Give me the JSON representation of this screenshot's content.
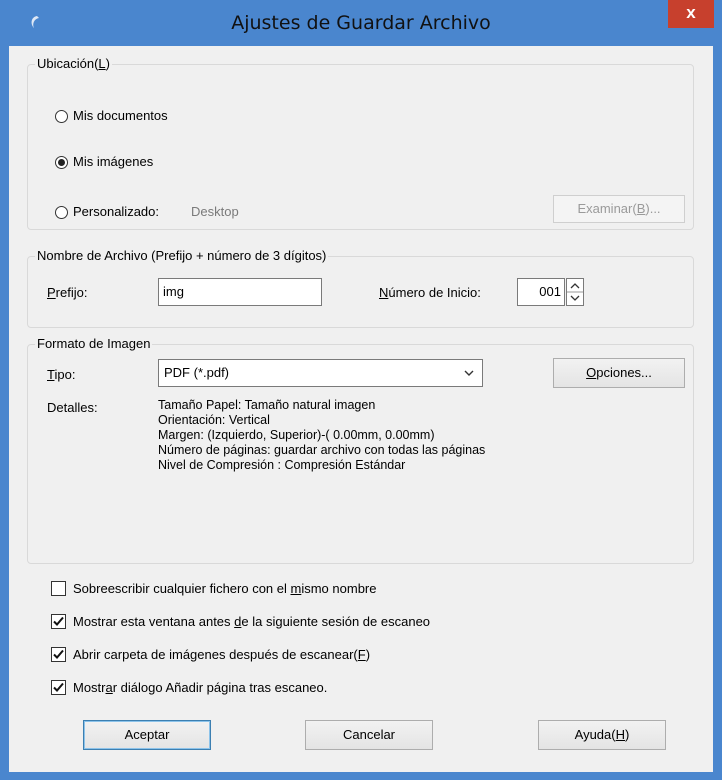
{
  "window": {
    "title": "Ajustes de Guardar Archivo",
    "close_glyph": "x"
  },
  "location": {
    "group_label_pre": "Ubicación(",
    "group_label_key": "L",
    "group_label_post": ")",
    "options": [
      {
        "label": "Mis documentos",
        "selected": false
      },
      {
        "label": "Mis imágenes",
        "selected": true
      },
      {
        "label": "Personalizado:",
        "selected": false
      }
    ],
    "custom_path": "Desktop",
    "browse_pre": "Examinar(",
    "browse_key": "B",
    "browse_post": ")..."
  },
  "filename": {
    "group_label": "Nombre de Archivo (Prefijo + número de 3 dígitos)",
    "prefix_key": "P",
    "prefix_rest": "refijo:",
    "prefix_value": "img",
    "start_key": "N",
    "start_rest": "úmero de Inicio:",
    "start_value": "001"
  },
  "format": {
    "group_label": "Formato de Imagen",
    "type_key": "T",
    "type_rest": "ipo:",
    "type_value": "PDF (*.pdf)",
    "options_key": "O",
    "options_rest": "pciones...",
    "details_label": "Detalles:",
    "details": [
      "Tamaño Papel: Tamaño natural imagen",
      "Orientación: Vertical",
      "Margen: (Izquierdo, Superior)-( 0.00mm, 0.00mm)",
      "Número de páginas: guardar archivo con todas las páginas",
      "Nivel de Compresión : Compresión Estándar"
    ]
  },
  "checkboxes": [
    {
      "pre": "Sobreescribir cualquier fichero con el ",
      "key": "m",
      "post": "ismo nombre",
      "checked": false
    },
    {
      "pre": "Mostrar esta ventana antes ",
      "key": "d",
      "post": "e la siguiente sesión de escaneo",
      "checked": true
    },
    {
      "pre": "Abrir carpeta de imágenes después de escanear(",
      "key": "F",
      "post": ")",
      "checked": true
    },
    {
      "pre": "Mostr",
      "key": "a",
      "post": "r diálogo Añadir página tras escaneo.",
      "checked": true
    }
  ],
  "buttons": {
    "accept": "Aceptar",
    "cancel": "Cancelar",
    "help_pre": "Ayuda(",
    "help_key": "H",
    "help_post": ")"
  }
}
